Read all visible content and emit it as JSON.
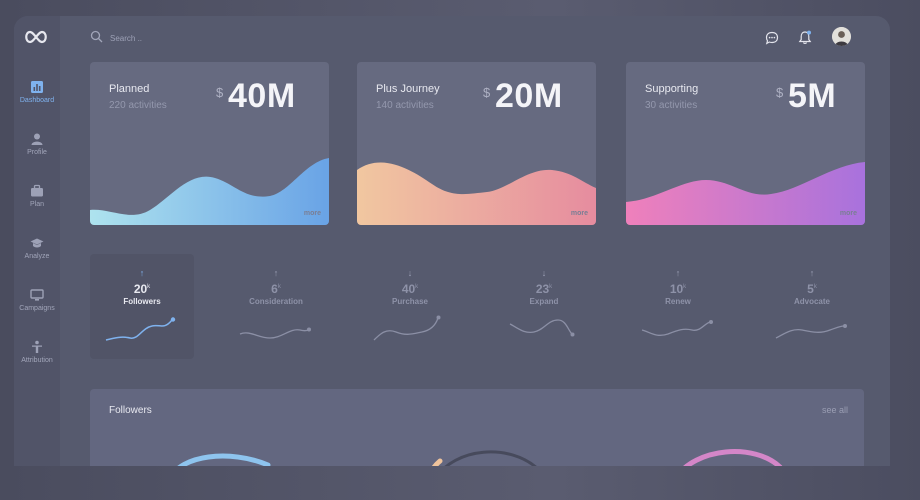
{
  "sidebar": {
    "items": [
      {
        "label": "Dashboard",
        "icon": "chart-icon"
      },
      {
        "label": "Profile",
        "icon": "user-icon"
      },
      {
        "label": "Plan",
        "icon": "briefcase-icon"
      },
      {
        "label": "Analyze",
        "icon": "graduation-cap-icon"
      },
      {
        "label": "Campaigns",
        "icon": "monitor-icon"
      },
      {
        "label": "Attribution",
        "icon": "person-icon"
      }
    ]
  },
  "header": {
    "search_placeholder": "Search ..",
    "icons": [
      "chat-icon",
      "bell-icon",
      "avatar"
    ]
  },
  "cards": [
    {
      "title": "Planned",
      "subtitle": "220 activities",
      "currency": "$",
      "amount": "40M",
      "more": "more"
    },
    {
      "title": "Plus Journey",
      "subtitle": "140 activities",
      "currency": "$",
      "amount": "20M",
      "more": "more"
    },
    {
      "title": "Supporting",
      "subtitle": "30 activities",
      "currency": "$",
      "amount": "5M",
      "more": "more"
    }
  ],
  "metrics": [
    {
      "arrow": "↑",
      "value": "20",
      "unit": "k",
      "name": "Followers"
    },
    {
      "arrow": "↑",
      "value": "6",
      "unit": "k",
      "name": "Consideration"
    },
    {
      "arrow": "↓",
      "value": "40",
      "unit": "k",
      "name": "Purchase"
    },
    {
      "arrow": "↓",
      "value": "23",
      "unit": "k",
      "name": "Expand"
    },
    {
      "arrow": "↑",
      "value": "10",
      "unit": "k",
      "name": "Renew"
    },
    {
      "arrow": "↑",
      "value": "5",
      "unit": "k",
      "name": "Advocate"
    }
  ],
  "followers_panel": {
    "title": "Followers",
    "see_all": "see all"
  },
  "colors": {
    "accent": "#7fb2ee",
    "card_bg": "#666a80",
    "planned_gradient": [
      "#a8dfee",
      "#6aa5e6"
    ],
    "journey_gradient": [
      "#f2c49a",
      "#e88fa0"
    ],
    "supporting_gradient": [
      "#ee7fbd",
      "#a973dc"
    ]
  }
}
